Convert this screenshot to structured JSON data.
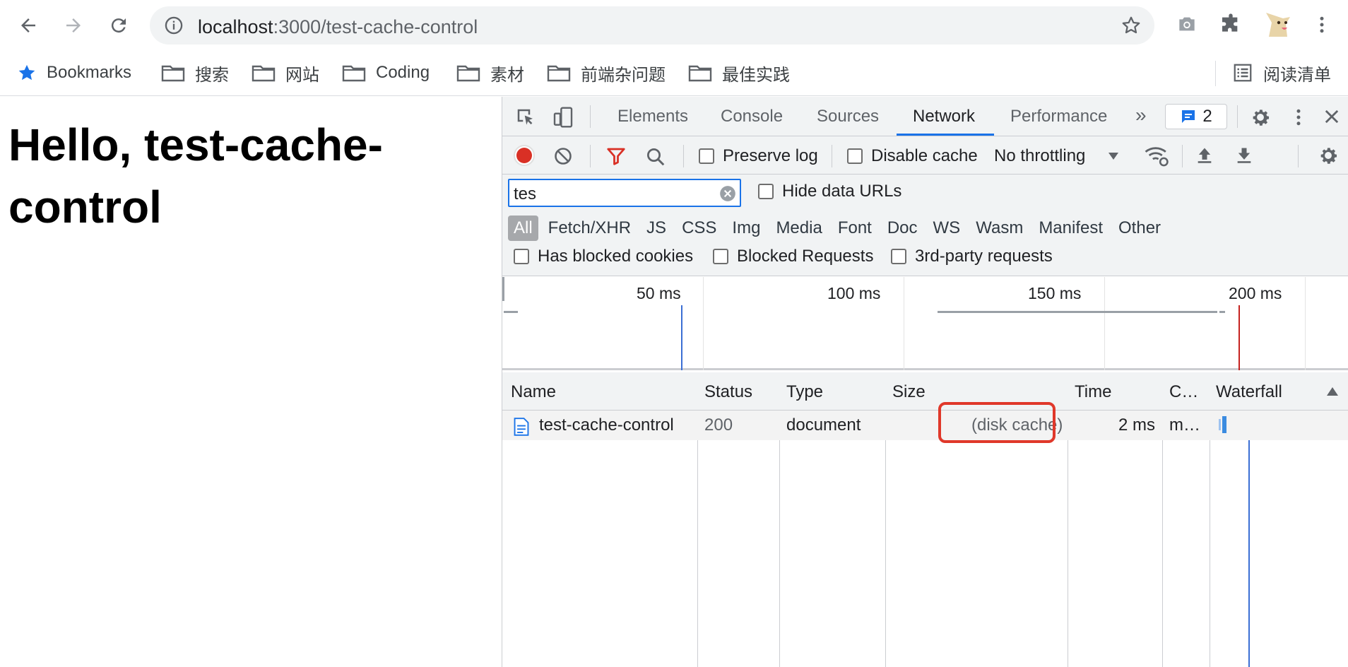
{
  "browser": {
    "url_host": "localhost",
    "url_path": ":3000/test-cache-control",
    "bookmarks": [
      {
        "label": "Bookmarks",
        "icon": "star-icon"
      },
      {
        "label": "搜索",
        "icon": "folder-icon"
      },
      {
        "label": "网站",
        "icon": "folder-icon"
      },
      {
        "label": "Coding",
        "icon": "folder-icon"
      },
      {
        "label": "素材",
        "icon": "folder-icon"
      },
      {
        "label": "前端杂问题",
        "icon": "folder-icon"
      },
      {
        "label": "最佳实践",
        "icon": "folder-icon"
      }
    ],
    "reading_list": "阅读清单"
  },
  "page": {
    "heading": "Hello, test-cache-control"
  },
  "devtools": {
    "tabs": [
      "Elements",
      "Console",
      "Sources",
      "Network",
      "Performance"
    ],
    "active_tab": "Network",
    "issues_count": "2",
    "toolbar": {
      "preserve_log": "Preserve log",
      "disable_cache": "Disable cache",
      "throttling": "No throttling"
    },
    "filter": {
      "value": "tes",
      "hide_data_urls": "Hide data URLs",
      "types": [
        "All",
        "Fetch/XHR",
        "JS",
        "CSS",
        "Img",
        "Media",
        "Font",
        "Doc",
        "WS",
        "Wasm",
        "Manifest",
        "Other"
      ],
      "active_type": "All",
      "has_blocked_cookies": "Has blocked cookies",
      "blocked_requests": "Blocked Requests",
      "third_party": "3rd-party requests"
    },
    "overview_ticks": [
      "50 ms",
      "100 ms",
      "150 ms",
      "200 ms"
    ],
    "table": {
      "columns": [
        "Name",
        "Status",
        "Type",
        "Size",
        "Time",
        "C…",
        "Waterfall"
      ],
      "rows": [
        {
          "name": "test-cache-control",
          "status": "200",
          "type": "document",
          "size": "(disk cache)",
          "time": "2 ms",
          "c": "m…"
        }
      ]
    },
    "colors": {
      "accent": "#1a73e8",
      "record": "#d93025",
      "highlight_box": "#e0382a",
      "load_line": "#c5221f"
    }
  }
}
